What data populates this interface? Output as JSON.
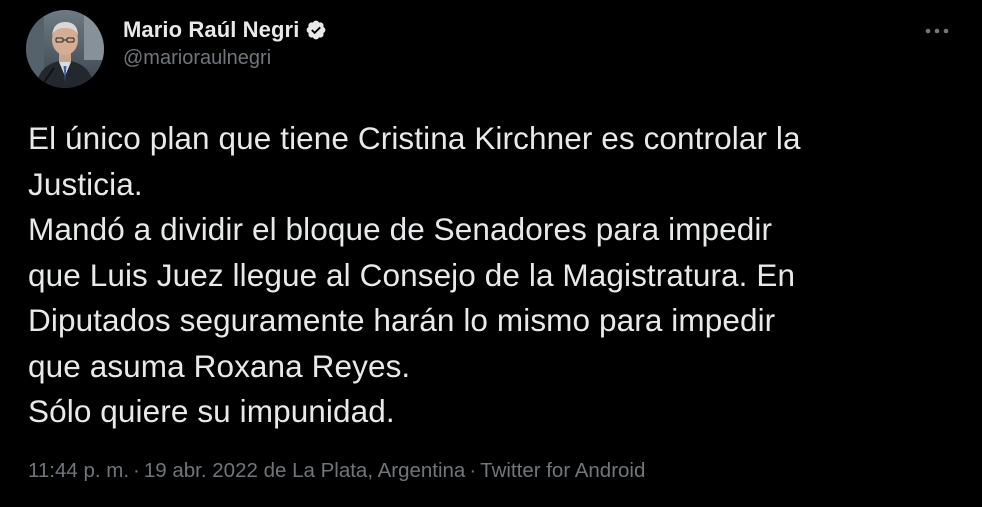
{
  "author": {
    "display_name": "Mario Raúl Negri",
    "handle": "@marioraulnegri",
    "verified_icon": "verified-badge-icon",
    "avatar_icon": "profile-photo"
  },
  "more_icon": "ellipsis-icon",
  "tweet": {
    "lines": [
      "El único plan que tiene Cristina Kirchner es controlar la",
      "Justicia.",
      "Mandó a dividir el bloque de Senadores para impedir",
      "que Luis Juez llegue al Consejo de la Magistratura. En",
      "Diputados seguramente harán lo mismo para impedir",
      "que asuma Roxana Reyes.",
      "Sólo quiere su impunidad."
    ]
  },
  "meta": {
    "time": "11:44 p. m.",
    "separator": "·",
    "date": "19 abr. 2022",
    "location_prefix": "de",
    "location": "La Plata, Argentina",
    "source": "Twitter for Android"
  },
  "colors": {
    "background": "#000000",
    "primary_text": "#e7e9ea",
    "secondary_text": "#71767b"
  }
}
